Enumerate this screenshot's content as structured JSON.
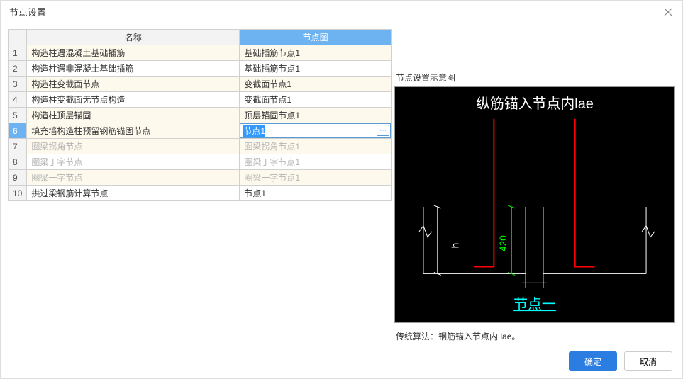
{
  "window": {
    "title": "节点设置"
  },
  "table": {
    "headers": {
      "name": "名称",
      "diagram": "节点图"
    },
    "rows": [
      {
        "num": "1",
        "name": "构造柱遇混凝土基础插筋",
        "diagram": "基础插筋节点1",
        "disabled": false
      },
      {
        "num": "2",
        "name": "构造柱遇非混凝土基础插筋",
        "diagram": "基础插筋节点1",
        "disabled": false
      },
      {
        "num": "3",
        "name": "构造柱变截面节点",
        "diagram": "变截面节点1",
        "disabled": false
      },
      {
        "num": "4",
        "name": "构造柱变截面无节点构造",
        "diagram": "变截面节点1",
        "disabled": false
      },
      {
        "num": "5",
        "name": "构造柱顶层锚固",
        "diagram": "顶层锚固节点1",
        "disabled": false
      },
      {
        "num": "6",
        "name": "填充墙构造柱预留钢筋锚固节点",
        "diagram": "节点1",
        "disabled": false,
        "selected": true,
        "editing": true
      },
      {
        "num": "7",
        "name": "圈梁拐角节点",
        "diagram": "圈梁拐角节点1",
        "disabled": true
      },
      {
        "num": "8",
        "name": "圈梁丁字节点",
        "diagram": "圈梁丁字节点1",
        "disabled": true
      },
      {
        "num": "9",
        "name": "圈梁一字节点",
        "diagram": "圈梁一字节点1",
        "disabled": true
      },
      {
        "num": "10",
        "name": "拱过梁钢筋计算节点",
        "diagram": "节点1",
        "disabled": false
      }
    ],
    "more_button_label": "⋯"
  },
  "preview": {
    "title": "节点设置示意图",
    "diagram_top_label": "纵筋锚入节点内lae",
    "diagram_h_label": "h",
    "diagram_value": "420",
    "diagram_bottom_label": "节点一",
    "algorithm_label": "传统算法：",
    "algorithm_text": "钢筋锚入节点内 lae。"
  },
  "footer": {
    "ok": "确定",
    "cancel": "取消"
  }
}
